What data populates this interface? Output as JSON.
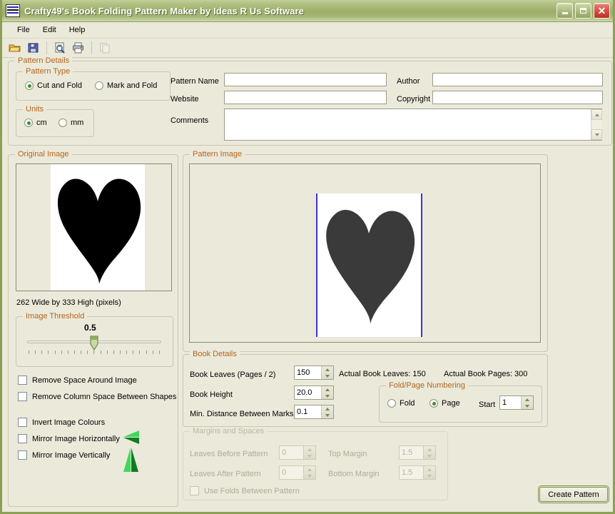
{
  "window": {
    "title": "Crafty49's Book Folding Pattern Maker by Ideas R Us Software",
    "minimize_label": "Minimize",
    "maximize_label": "Maximize",
    "close_label": "Close"
  },
  "menu": {
    "items": [
      {
        "label": "File"
      },
      {
        "label": "Edit"
      },
      {
        "label": "Help"
      }
    ]
  },
  "toolbar": {
    "buttons": [
      {
        "name": "open-icon",
        "title": "Open"
      },
      {
        "name": "save-icon",
        "title": "Save"
      },
      {
        "name": "print-preview-icon",
        "title": "Print Preview"
      },
      {
        "name": "print-icon",
        "title": "Print"
      },
      {
        "name": "copy-icon",
        "title": "Copy",
        "disabled": true
      }
    ]
  },
  "pattern_details": {
    "legend": "Pattern Details",
    "pattern_type": {
      "legend": "Pattern Type",
      "options": [
        {
          "label": "Cut and Fold",
          "selected": true
        },
        {
          "label": "Mark and Fold",
          "selected": false
        }
      ]
    },
    "units": {
      "legend": "Units",
      "options": [
        {
          "label": "cm",
          "selected": true
        },
        {
          "label": "mm",
          "selected": false
        }
      ]
    },
    "fields": {
      "pattern_name_label": "Pattern Name",
      "pattern_name_value": "",
      "website_label": "Website",
      "website_value": "",
      "comments_label": "Comments",
      "comments_value": "",
      "author_label": "Author",
      "author_value": "",
      "copyright_label": "Copyright",
      "copyright_value": ""
    }
  },
  "original_image": {
    "legend": "Original Image",
    "dimensions_text": "262 Wide by 333 High (pixels)",
    "threshold": {
      "legend": "Image Threshold",
      "value": "0.5",
      "position_pct": 50,
      "tick_count": 21
    },
    "checkboxes": [
      {
        "label": "Remove Space Around Image",
        "checked": false
      },
      {
        "label": "Remove Column Space Between Shapes",
        "checked": false
      },
      {
        "label": "Invert Image Colours",
        "checked": false
      },
      {
        "label": "Mirror Image Horizontally",
        "checked": false,
        "icon": "mirror-horizontal-icon"
      },
      {
        "label": "Mirror Image Vertically",
        "checked": false,
        "icon": "mirror-vertical-icon"
      }
    ]
  },
  "pattern_image": {
    "legend": "Pattern Image",
    "page_border_color": "#3a34d8",
    "shape_color": "#3a3a3a"
  },
  "book_details": {
    "legend": "Book Details",
    "book_leaves_label": "Book Leaves (Pages / 2)",
    "book_leaves_value": "150",
    "actual_leaves_text": "Actual Book Leaves: 150",
    "actual_pages_text": "Actual Book Pages: 300",
    "book_height_label": "Book Height",
    "book_height_value": "20.0",
    "min_distance_label": "Min. Distance Between Marks",
    "min_distance_value": "0.1",
    "numbering": {
      "legend": "Fold/Page Numbering",
      "options": [
        {
          "label": "Fold",
          "selected": false
        },
        {
          "label": "Page",
          "selected": true
        }
      ],
      "start_label": "Start",
      "start_value": "1"
    }
  },
  "margins": {
    "legend": "Margins and Spaces",
    "disabled": true,
    "leaves_before_label": "Leaves Before Pattern",
    "leaves_before_value": "0",
    "leaves_after_label": "Leaves After Pattern",
    "leaves_after_value": "0",
    "top_margin_label": "Top Margin",
    "top_margin_value": "1.5",
    "bottom_margin_label": "Bottom Margin",
    "bottom_margin_value": "1.5",
    "use_folds_label": "Use Folds Between Pattern",
    "use_folds_checked": false
  },
  "actions": {
    "create_pattern_label": "Create Pattern"
  },
  "colors": {
    "window_background": "#ebe9da",
    "titlebar_green": "#9aae67",
    "legend_orange": "#b5651d",
    "accent_green": "#3f8c2f"
  }
}
